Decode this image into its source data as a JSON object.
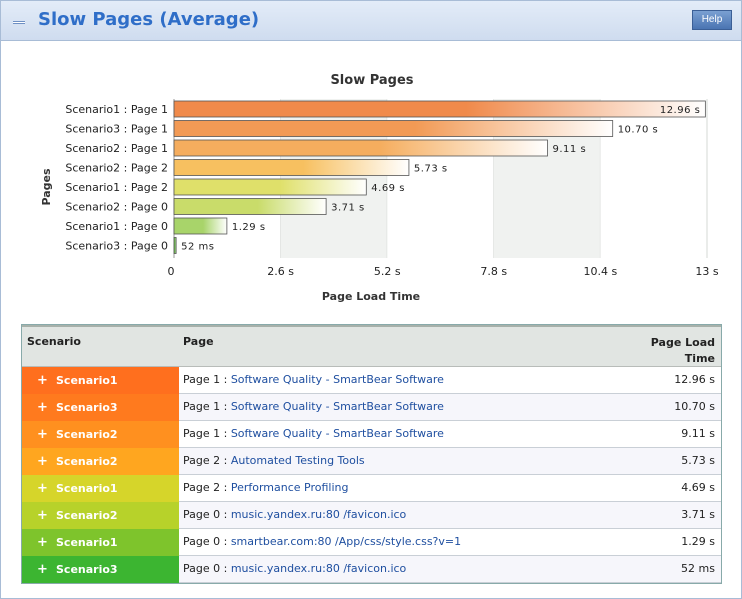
{
  "header": {
    "title": "Slow Pages (Average)",
    "help_label": "Help"
  },
  "chart_data": {
    "type": "bar",
    "orientation": "horizontal",
    "title": "Slow Pages",
    "xlabel": "Page Load Time",
    "ylabel": "Pages",
    "xlim": [
      0,
      13
    ],
    "x_ticks": [
      "0",
      "2.6 s",
      "5.2 s",
      "7.8 s",
      "10.4 s",
      "13 s"
    ],
    "categories": [
      "Scenario1 : Page 1",
      "Scenario3 : Page 1",
      "Scenario2 : Page 1",
      "Scenario2 : Page 2",
      "Scenario1 : Page 2",
      "Scenario2 : Page 0",
      "Scenario1 : Page 0",
      "Scenario3 : Page 0"
    ],
    "values": [
      12.96,
      10.7,
      9.11,
      5.73,
      4.69,
      3.71,
      1.29,
      0.052
    ],
    "value_labels": [
      "12.96 s",
      "10.70 s",
      "9.11 s",
      "5.73 s",
      "4.69 s",
      "3.71 s",
      "1.29 s",
      "52 ms"
    ],
    "colors": [
      "#f08a4b",
      "#f29a55",
      "#f5ad5e",
      "#f7c060",
      "#dfe06a",
      "#c9dc6a",
      "#a8d46a",
      "#6cc04a"
    ],
    "grid": true
  },
  "table": {
    "columns": {
      "scenario": "Scenario",
      "page": "Page",
      "time": "Page Load Time"
    },
    "rows": [
      {
        "scenario": "Scenario1",
        "page_prefix": "Page 1 : ",
        "page_link": "Software Quality - SmartBear Software",
        "time": "12.96 s",
        "color": "#ff6f1e"
      },
      {
        "scenario": "Scenario3",
        "page_prefix": "Page 1 : ",
        "page_link": "Software Quality - SmartBear Software",
        "time": "10.70 s",
        "color": "#ff7a1e"
      },
      {
        "scenario": "Scenario2",
        "page_prefix": "Page 1 : ",
        "page_link": "Software Quality - SmartBear Software",
        "time": "9.11 s",
        "color": "#ff901f"
      },
      {
        "scenario": "Scenario2",
        "page_prefix": "Page 2 : ",
        "page_link": "Automated Testing Tools",
        "time": "5.73 s",
        "color": "#ffa61f"
      },
      {
        "scenario": "Scenario1",
        "page_prefix": "Page 2 : ",
        "page_link": "Performance Profiling",
        "time": "4.69 s",
        "color": "#d6d52a"
      },
      {
        "scenario": "Scenario2",
        "page_prefix": "Page 0 : ",
        "page_link": "music.yandex.ru:80 /favicon.ico",
        "time": "3.71 s",
        "color": "#b7d22a"
      },
      {
        "scenario": "Scenario1",
        "page_prefix": "Page 0 : ",
        "page_link": "smartbear.com:80 /App/css/style.css?v=1",
        "time": "1.29 s",
        "color": "#7ec42c"
      },
      {
        "scenario": "Scenario3",
        "page_prefix": "Page 0 : ",
        "page_link": "music.yandex.ru:80 /favicon.ico",
        "time": "52 ms",
        "color": "#3cb531"
      }
    ]
  }
}
